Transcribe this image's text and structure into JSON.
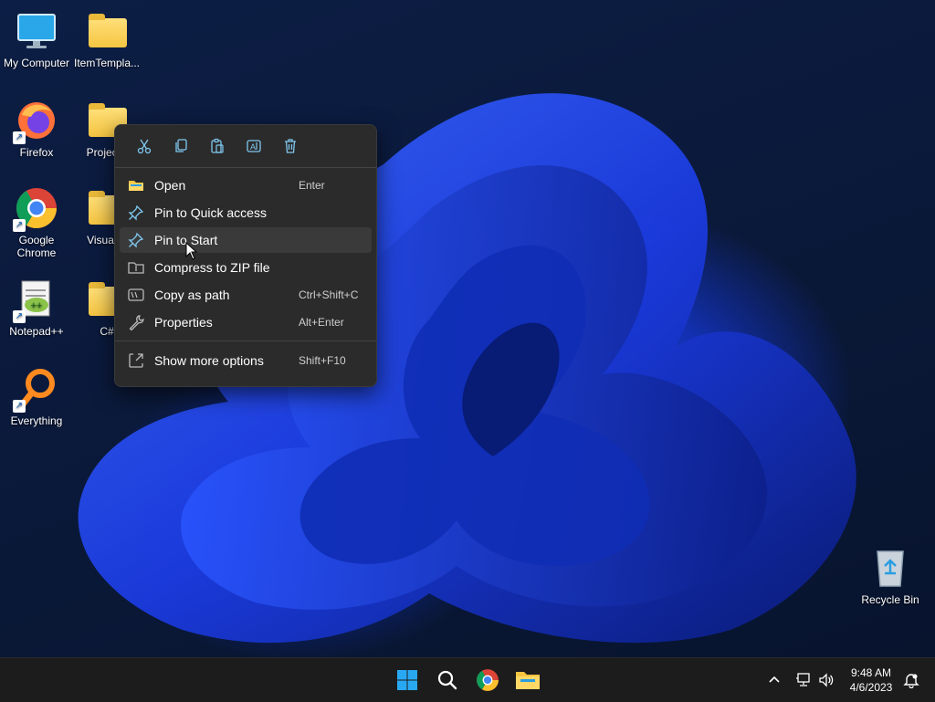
{
  "desktop": {
    "icons": [
      {
        "label": "My Computer",
        "icon": "monitor-icon"
      },
      {
        "label": "ItemTempla...",
        "icon": "folder-icon"
      },
      {
        "label": "Firefox",
        "icon": "firefox-icon"
      },
      {
        "label": "ProjectT",
        "icon": "folder-icon"
      },
      {
        "label": "Google Chrome",
        "icon": "chrome-icon"
      },
      {
        "label": "Visual E",
        "icon": "folder-icon"
      },
      {
        "label": "Notepad++",
        "icon": "notepad-plus-plus-icon"
      },
      {
        "label": "C#",
        "icon": "folder-icon"
      },
      {
        "label": "Everything",
        "icon": "everything-search-icon"
      },
      {
        "label": "Recycle Bin",
        "icon": "recycle-bin-icon"
      }
    ]
  },
  "context_menu": {
    "quick_actions": [
      "cut-icon",
      "copy-icon",
      "paste-icon",
      "rename-icon",
      "delete-icon"
    ],
    "items": [
      {
        "label": "Open",
        "shortcut": "Enter",
        "icon": "folder-open-icon"
      },
      {
        "label": "Pin to Quick access",
        "shortcut": "",
        "icon": "pin-icon"
      },
      {
        "label": "Pin to Start",
        "shortcut": "",
        "icon": "pin-icon"
      },
      {
        "label": "Compress to ZIP file",
        "shortcut": "",
        "icon": "zip-icon"
      },
      {
        "label": "Copy as path",
        "shortcut": "Ctrl+Shift+C",
        "icon": "copy-path-icon"
      },
      {
        "label": "Properties",
        "shortcut": "Alt+Enter",
        "icon": "wrench-icon"
      },
      {
        "label": "Show more options",
        "shortcut": "Shift+F10",
        "icon": "more-options-icon"
      }
    ],
    "hovered_item": "Pin to Start"
  },
  "taskbar": {
    "apps": [
      "start-icon",
      "search-icon",
      "chrome-icon",
      "file-explorer-icon"
    ],
    "tray": [
      "chevron-up-icon",
      "network-icon",
      "volume-icon"
    ],
    "clock": {
      "time": "9:48 AM",
      "date": "4/6/2023"
    },
    "notification_icon": "notification-bell-icon"
  },
  "colors": {
    "menu_bg": "#2b2b2b",
    "accent": "#4cc2ff",
    "taskbar_bg": "#1c1c1c"
  }
}
